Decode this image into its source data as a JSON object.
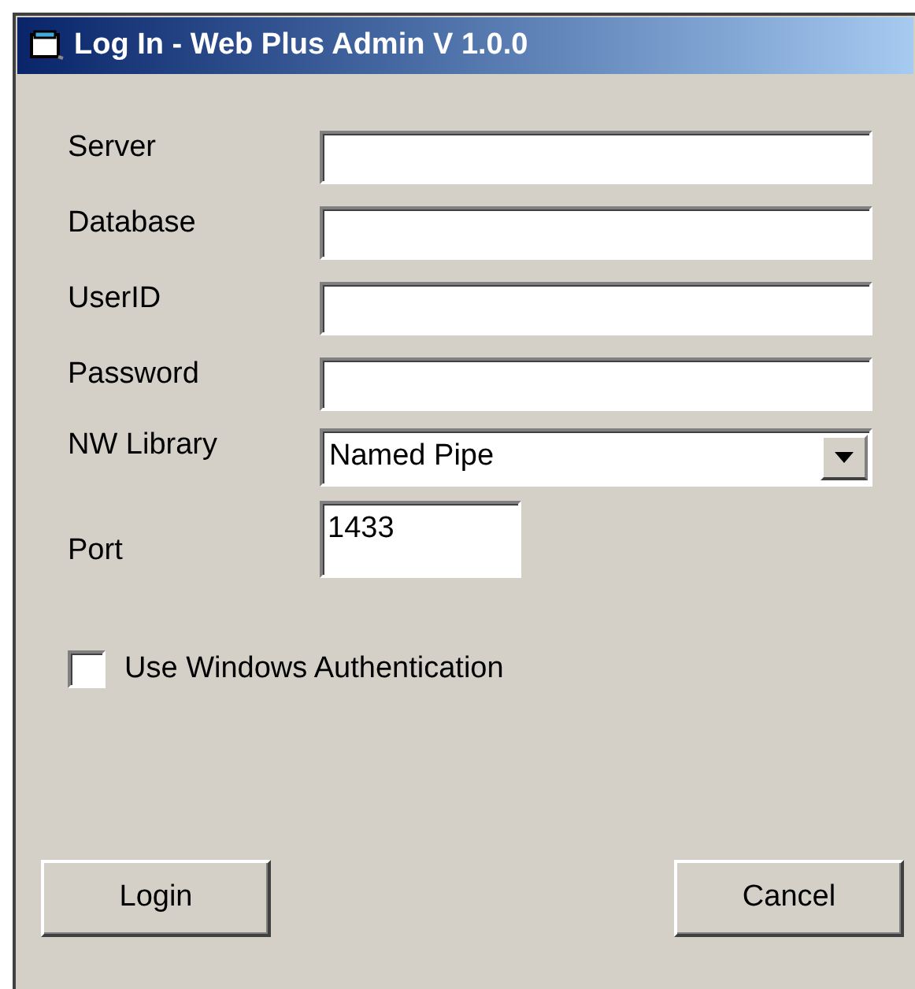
{
  "window": {
    "title": "Log In - Web Plus Admin V 1.0.0"
  },
  "fields": [
    {
      "label": "Server",
      "kind": "text"
    },
    {
      "label": "Database",
      "kind": "text"
    },
    {
      "label": "UserID",
      "kind": "text"
    },
    {
      "label": "Password",
      "kind": "text"
    },
    {
      "label": "NW Library",
      "kind": "select",
      "value": "Named Pipe"
    },
    {
      "label": "Port",
      "kind": "short",
      "value": "1433"
    }
  ],
  "checkbox": {
    "label": "Use Windows Authentication",
    "checked": false
  },
  "buttons": [
    "Login",
    "Cancel"
  ]
}
